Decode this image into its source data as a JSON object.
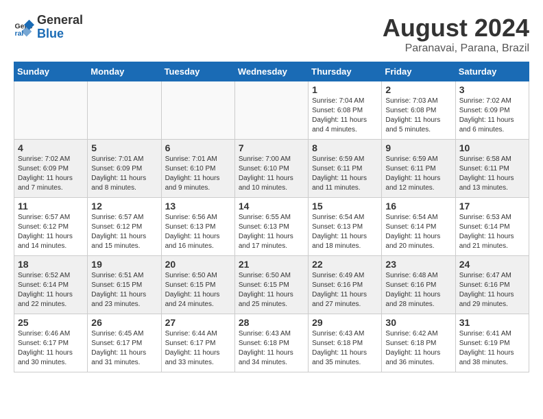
{
  "header": {
    "logo_line1": "General",
    "logo_line2": "Blue",
    "month_year": "August 2024",
    "location": "Paranavai, Parana, Brazil"
  },
  "days_of_week": [
    "Sunday",
    "Monday",
    "Tuesday",
    "Wednesday",
    "Thursday",
    "Friday",
    "Saturday"
  ],
  "weeks": [
    [
      {
        "num": "",
        "info": "",
        "empty": true
      },
      {
        "num": "",
        "info": "",
        "empty": true
      },
      {
        "num": "",
        "info": "",
        "empty": true
      },
      {
        "num": "",
        "info": "",
        "empty": true
      },
      {
        "num": "1",
        "info": "Sunrise: 7:04 AM\nSunset: 6:08 PM\nDaylight: 11 hours\nand 4 minutes.",
        "empty": false
      },
      {
        "num": "2",
        "info": "Sunrise: 7:03 AM\nSunset: 6:08 PM\nDaylight: 11 hours\nand 5 minutes.",
        "empty": false
      },
      {
        "num": "3",
        "info": "Sunrise: 7:02 AM\nSunset: 6:09 PM\nDaylight: 11 hours\nand 6 minutes.",
        "empty": false
      }
    ],
    [
      {
        "num": "4",
        "info": "Sunrise: 7:02 AM\nSunset: 6:09 PM\nDaylight: 11 hours\nand 7 minutes.",
        "empty": false
      },
      {
        "num": "5",
        "info": "Sunrise: 7:01 AM\nSunset: 6:09 PM\nDaylight: 11 hours\nand 8 minutes.",
        "empty": false
      },
      {
        "num": "6",
        "info": "Sunrise: 7:01 AM\nSunset: 6:10 PM\nDaylight: 11 hours\nand 9 minutes.",
        "empty": false
      },
      {
        "num": "7",
        "info": "Sunrise: 7:00 AM\nSunset: 6:10 PM\nDaylight: 11 hours\nand 10 minutes.",
        "empty": false
      },
      {
        "num": "8",
        "info": "Sunrise: 6:59 AM\nSunset: 6:11 PM\nDaylight: 11 hours\nand 11 minutes.",
        "empty": false
      },
      {
        "num": "9",
        "info": "Sunrise: 6:59 AM\nSunset: 6:11 PM\nDaylight: 11 hours\nand 12 minutes.",
        "empty": false
      },
      {
        "num": "10",
        "info": "Sunrise: 6:58 AM\nSunset: 6:11 PM\nDaylight: 11 hours\nand 13 minutes.",
        "empty": false
      }
    ],
    [
      {
        "num": "11",
        "info": "Sunrise: 6:57 AM\nSunset: 6:12 PM\nDaylight: 11 hours\nand 14 minutes.",
        "empty": false
      },
      {
        "num": "12",
        "info": "Sunrise: 6:57 AM\nSunset: 6:12 PM\nDaylight: 11 hours\nand 15 minutes.",
        "empty": false
      },
      {
        "num": "13",
        "info": "Sunrise: 6:56 AM\nSunset: 6:13 PM\nDaylight: 11 hours\nand 16 minutes.",
        "empty": false
      },
      {
        "num": "14",
        "info": "Sunrise: 6:55 AM\nSunset: 6:13 PM\nDaylight: 11 hours\nand 17 minutes.",
        "empty": false
      },
      {
        "num": "15",
        "info": "Sunrise: 6:54 AM\nSunset: 6:13 PM\nDaylight: 11 hours\nand 18 minutes.",
        "empty": false
      },
      {
        "num": "16",
        "info": "Sunrise: 6:54 AM\nSunset: 6:14 PM\nDaylight: 11 hours\nand 20 minutes.",
        "empty": false
      },
      {
        "num": "17",
        "info": "Sunrise: 6:53 AM\nSunset: 6:14 PM\nDaylight: 11 hours\nand 21 minutes.",
        "empty": false
      }
    ],
    [
      {
        "num": "18",
        "info": "Sunrise: 6:52 AM\nSunset: 6:14 PM\nDaylight: 11 hours\nand 22 minutes.",
        "empty": false
      },
      {
        "num": "19",
        "info": "Sunrise: 6:51 AM\nSunset: 6:15 PM\nDaylight: 11 hours\nand 23 minutes.",
        "empty": false
      },
      {
        "num": "20",
        "info": "Sunrise: 6:50 AM\nSunset: 6:15 PM\nDaylight: 11 hours\nand 24 minutes.",
        "empty": false
      },
      {
        "num": "21",
        "info": "Sunrise: 6:50 AM\nSunset: 6:15 PM\nDaylight: 11 hours\nand 25 minutes.",
        "empty": false
      },
      {
        "num": "22",
        "info": "Sunrise: 6:49 AM\nSunset: 6:16 PM\nDaylight: 11 hours\nand 27 minutes.",
        "empty": false
      },
      {
        "num": "23",
        "info": "Sunrise: 6:48 AM\nSunset: 6:16 PM\nDaylight: 11 hours\nand 28 minutes.",
        "empty": false
      },
      {
        "num": "24",
        "info": "Sunrise: 6:47 AM\nSunset: 6:16 PM\nDaylight: 11 hours\nand 29 minutes.",
        "empty": false
      }
    ],
    [
      {
        "num": "25",
        "info": "Sunrise: 6:46 AM\nSunset: 6:17 PM\nDaylight: 11 hours\nand 30 minutes.",
        "empty": false
      },
      {
        "num": "26",
        "info": "Sunrise: 6:45 AM\nSunset: 6:17 PM\nDaylight: 11 hours\nand 31 minutes.",
        "empty": false
      },
      {
        "num": "27",
        "info": "Sunrise: 6:44 AM\nSunset: 6:17 PM\nDaylight: 11 hours\nand 33 minutes.",
        "empty": false
      },
      {
        "num": "28",
        "info": "Sunrise: 6:43 AM\nSunset: 6:18 PM\nDaylight: 11 hours\nand 34 minutes.",
        "empty": false
      },
      {
        "num": "29",
        "info": "Sunrise: 6:43 AM\nSunset: 6:18 PM\nDaylight: 11 hours\nand 35 minutes.",
        "empty": false
      },
      {
        "num": "30",
        "info": "Sunrise: 6:42 AM\nSunset: 6:18 PM\nDaylight: 11 hours\nand 36 minutes.",
        "empty": false
      },
      {
        "num": "31",
        "info": "Sunrise: 6:41 AM\nSunset: 6:19 PM\nDaylight: 11 hours\nand 38 minutes.",
        "empty": false
      }
    ]
  ]
}
